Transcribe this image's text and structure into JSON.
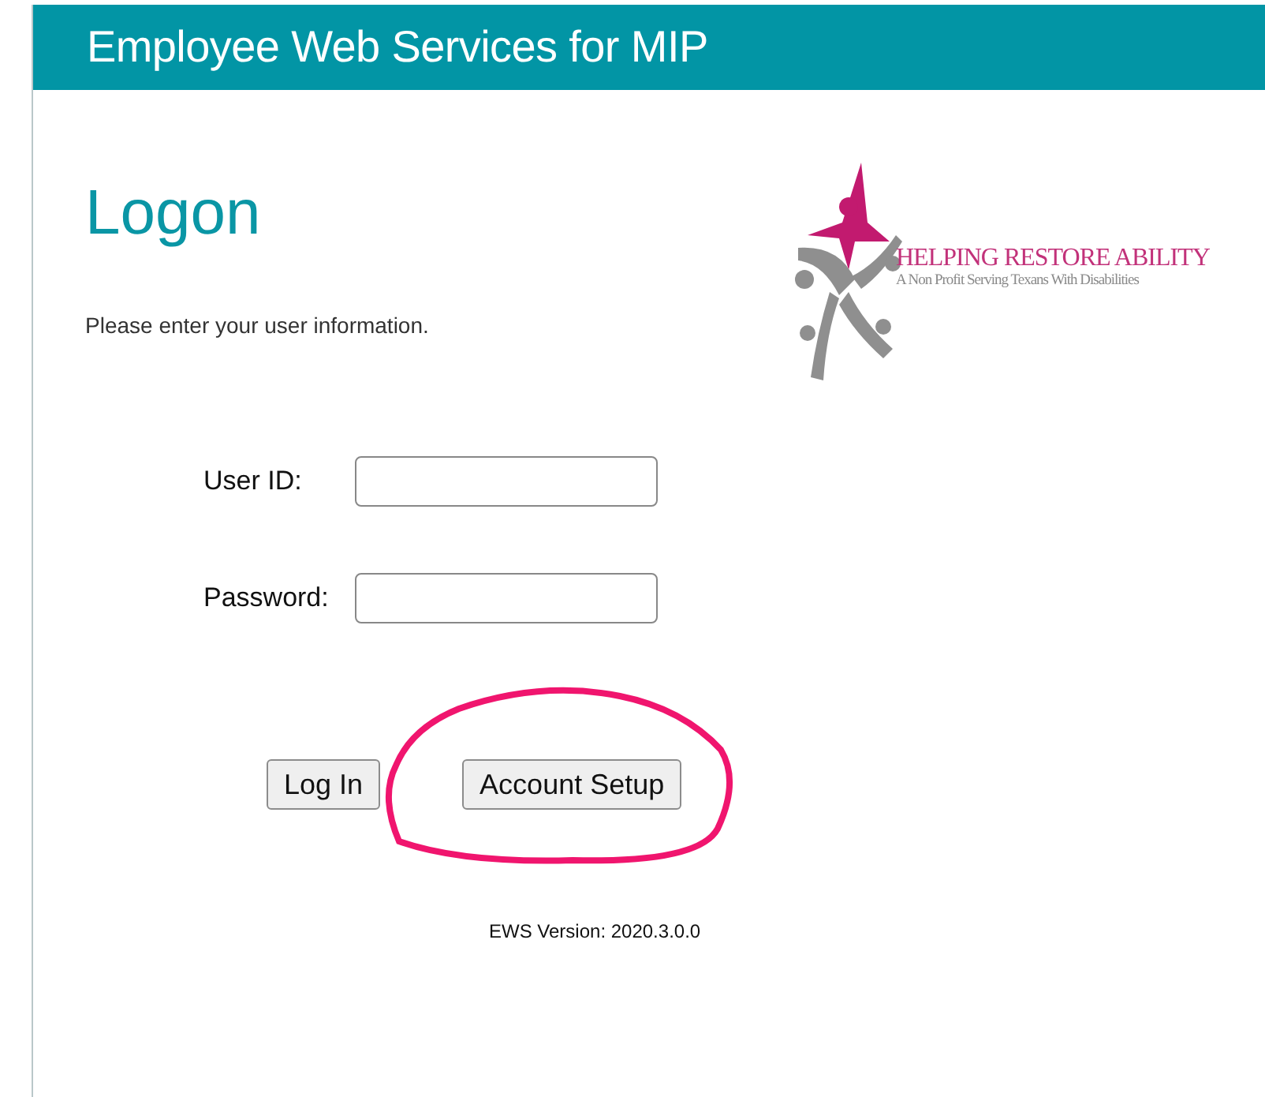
{
  "header": {
    "title": "Employee Web Services for MIP"
  },
  "page": {
    "title": "Logon",
    "subtitle": "Please enter your user information."
  },
  "logo": {
    "name": "HELPING RESTORE ABILITY",
    "tagline": "A Non Profit Serving Texans With Disabilities"
  },
  "fields": [
    {
      "label": "User ID:"
    },
    {
      "label": "Password:"
    }
  ],
  "buttons": [
    {
      "label": "Log In",
      "highlighted": false
    },
    {
      "label": "Account Setup",
      "highlighted": true
    }
  ],
  "version": "EWS Version: 2020.3.0.0"
}
